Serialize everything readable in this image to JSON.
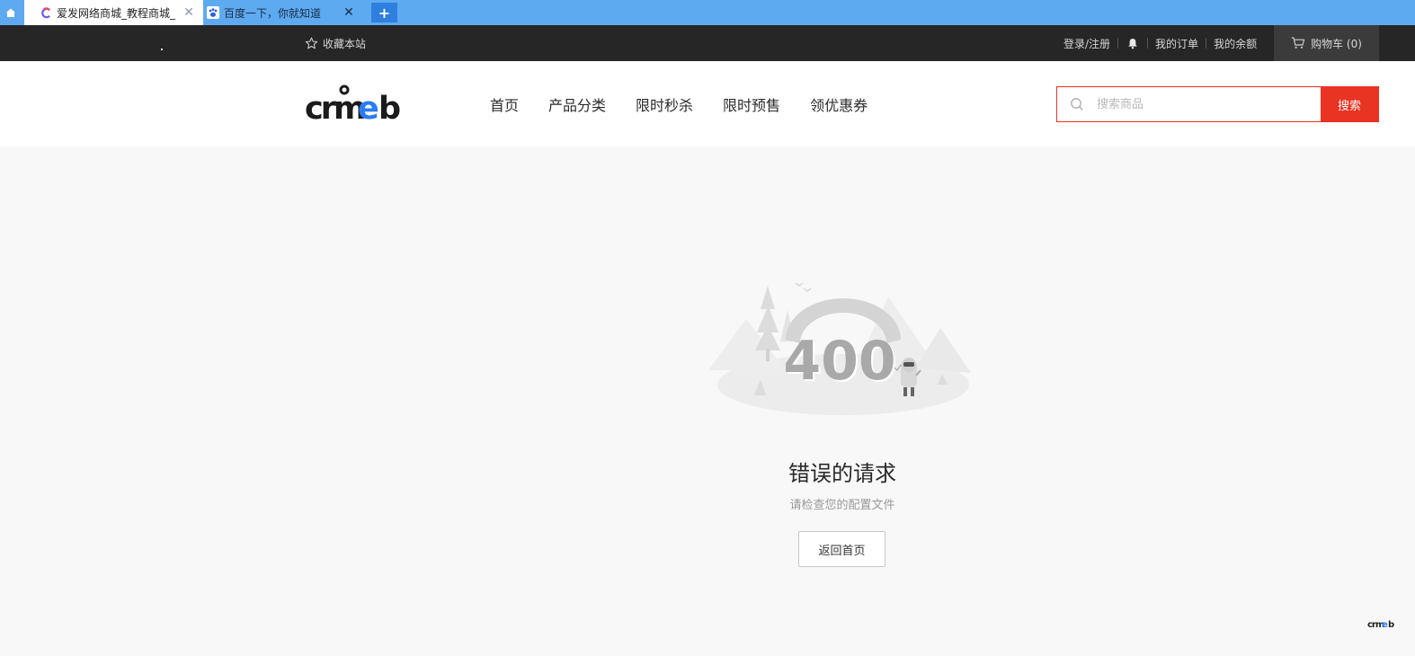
{
  "browser": {
    "tabs": [
      {
        "title": "爱发网络商城_教程商城_",
        "favicon": "crmeb-c-icon",
        "active": true
      },
      {
        "title": "百度一下，你就知道",
        "favicon": "baidu-paw-icon",
        "active": false
      }
    ],
    "new_tab": "+"
  },
  "topbar": {
    "favorite_label": "收藏本站",
    "login": "登录/注册",
    "orders": "我的订单",
    "balance": "我的余额",
    "cart": "购物车 (0)"
  },
  "header": {
    "logo_text": "crmeb",
    "nav": [
      "首页",
      "产品分类",
      "限时秒杀",
      "限时预售",
      "领优惠券"
    ],
    "search": {
      "placeholder": "搜索商品",
      "button": "搜索"
    }
  },
  "error": {
    "code": "400",
    "title": "错误的请求",
    "subtitle": "请检查您的配置文件",
    "back_button": "返回首页"
  },
  "colors": {
    "accent": "#e93323",
    "tabbar": "#5eaaf1",
    "topbar": "#262626"
  }
}
